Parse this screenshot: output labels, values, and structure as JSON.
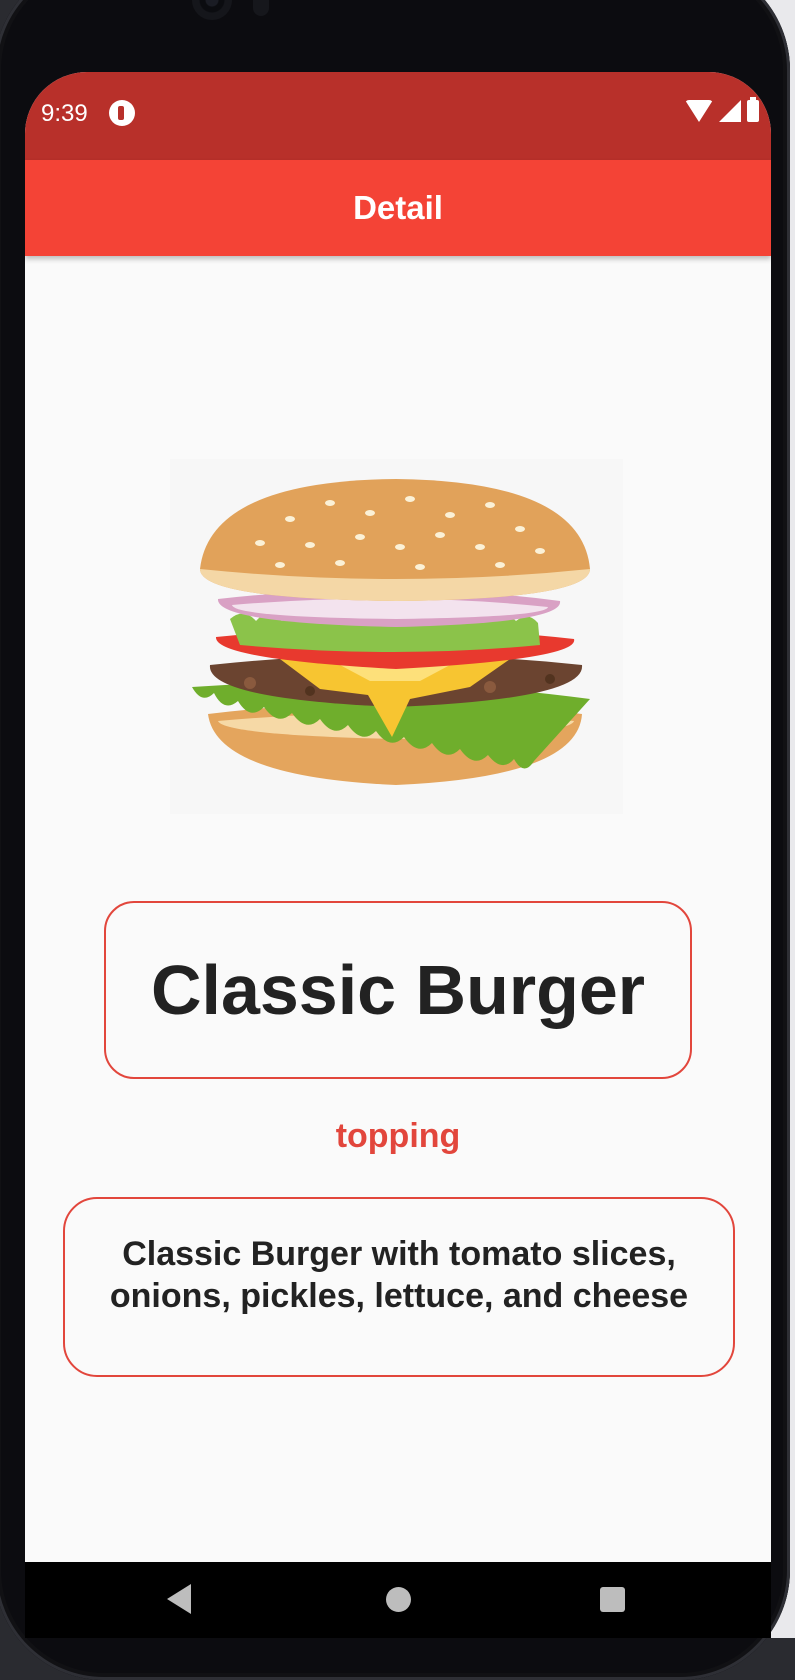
{
  "status_bar": {
    "time": "9:39"
  },
  "app_bar": {
    "title": "Detail"
  },
  "product": {
    "image": "classic-burger-photo",
    "name": "Classic Burger",
    "category": "topping",
    "description": "Classic Burger with tomato slices, onions, pickles,  lettuce, and cheese"
  },
  "colors": {
    "status_bar": "#b8302a",
    "app_bar": "#f44336",
    "accent": "#e2463c",
    "text": "#222222",
    "background": "#fafafa"
  },
  "icons": {
    "status": [
      "app-notification-icon",
      "wifi-icon",
      "signal-icon",
      "battery-icon"
    ],
    "nav": [
      "back-icon",
      "home-icon",
      "recents-icon"
    ]
  }
}
